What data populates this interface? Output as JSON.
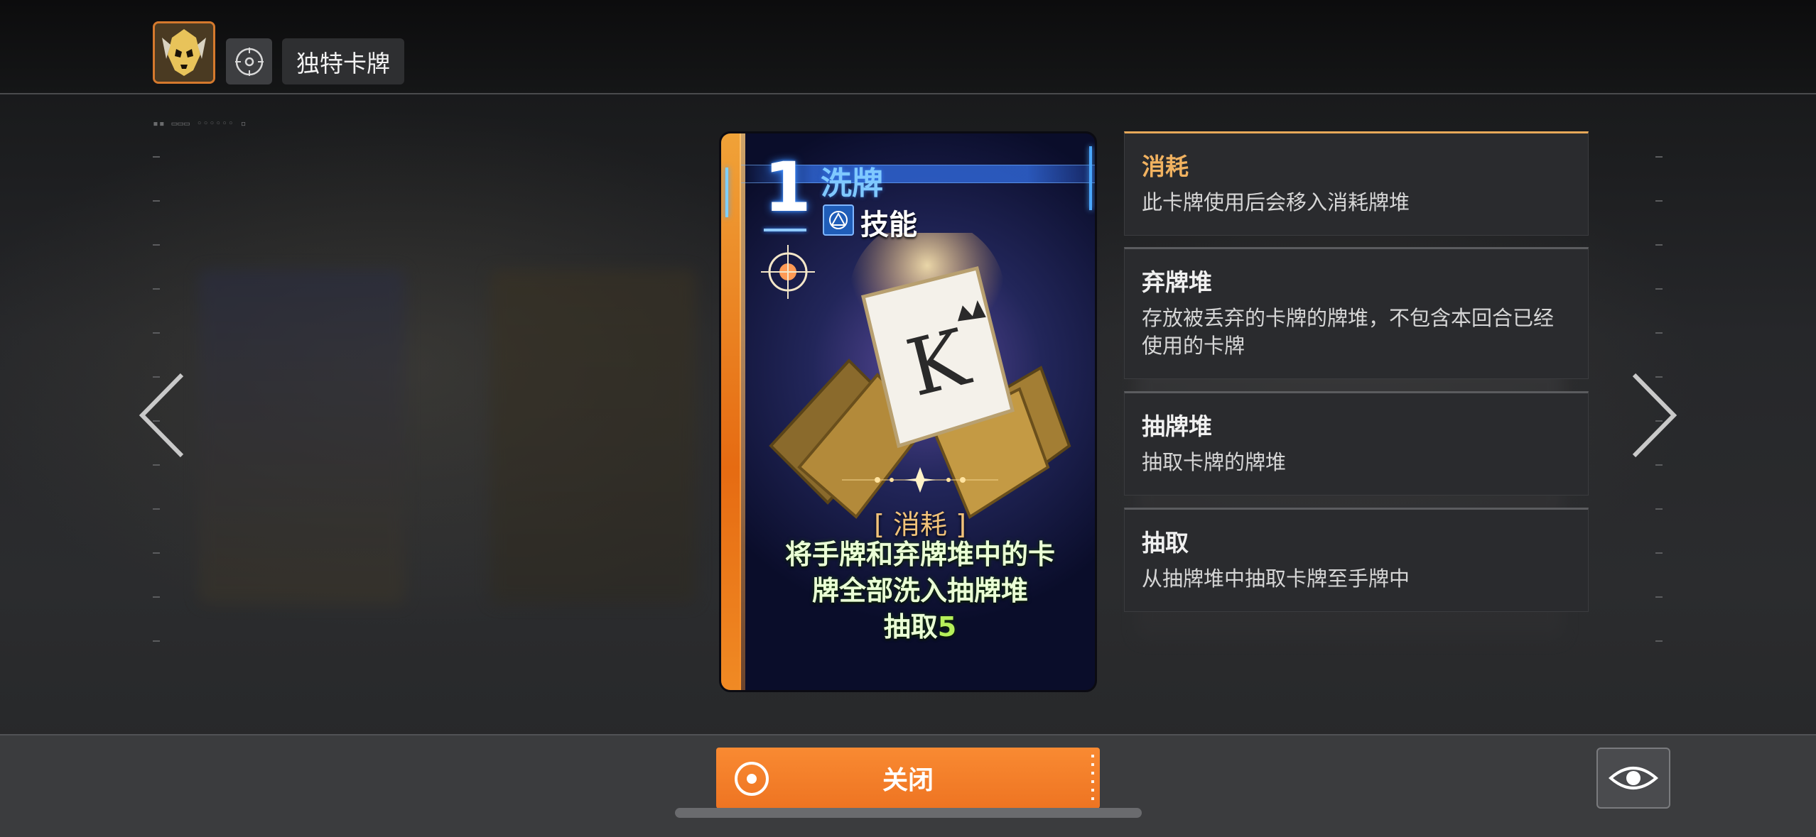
{
  "header": {
    "title": "独特卡牌"
  },
  "card": {
    "cost": "1",
    "name": "洗牌",
    "type": "技能",
    "tag": "[ 消耗 ]",
    "desc_line1": "将手牌和弃牌堆中的卡",
    "desc_line2": "牌全部洗入抽牌堆",
    "desc_line3_prefix": "抽取",
    "desc_line3_number": "5"
  },
  "keywords": [
    {
      "title": "消耗",
      "desc": "此卡牌使用后会移入消耗牌堆",
      "active": true
    },
    {
      "title": "弃牌堆",
      "desc": "存放被丢弃的卡牌的牌堆，不包含本回合已经使用的卡牌",
      "active": false
    },
    {
      "title": "抽牌堆",
      "desc": "抽取卡牌的牌堆",
      "active": false
    },
    {
      "title": "抽取",
      "desc": "从抽牌堆中抽取卡牌至手牌中",
      "active": false
    }
  ],
  "footer": {
    "close_label": "关闭"
  },
  "colors": {
    "accent_orange": "#f98a32",
    "keyword_active": "#f1b260",
    "card_name_blue": "#7fc8ff",
    "desc_green": "#eaffd6",
    "number_green": "#b6f05a"
  },
  "icons": {
    "avatar": "golden-skull-avatar",
    "mode": "target-icon",
    "card_type": "triangle-skill-icon",
    "nav_left": "chevron-left-icon",
    "nav_right": "chevron-right-icon",
    "close": "radio-circle-icon",
    "view": "eye-icon"
  }
}
